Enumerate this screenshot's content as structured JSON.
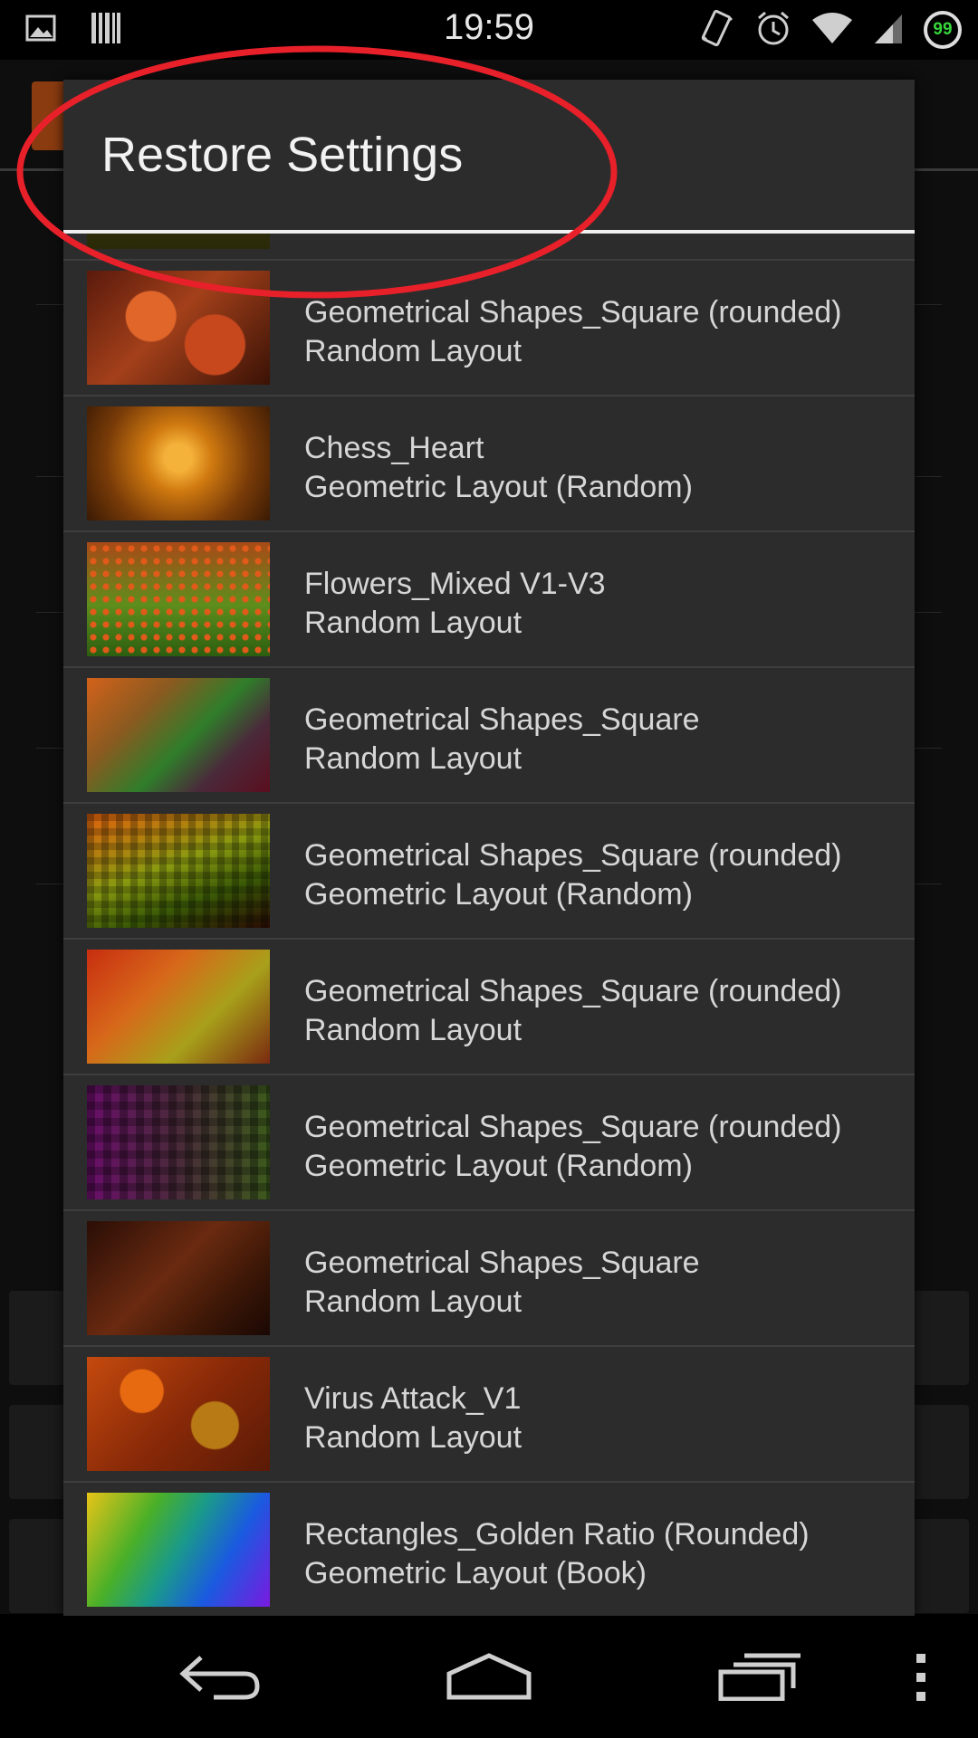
{
  "status_bar": {
    "time": "19:59",
    "battery_level": "99",
    "left_icons": [
      "image-icon",
      "barcode-icon"
    ],
    "right_icons": [
      "vibrate-icon",
      "alarm-icon",
      "wifi-icon",
      "signal-icon",
      "battery-icon"
    ]
  },
  "dialog": {
    "title": "Restore Settings",
    "items": [
      {
        "name": "",
        "layout": ""
      },
      {
        "name": "Geometrical Shapes_Square (rounded)",
        "layout": "Random Layout"
      },
      {
        "name": "Chess_Heart",
        "layout": "Geometric Layout (Random)"
      },
      {
        "name": "Flowers_Mixed V1-V3",
        "layout": "Random Layout"
      },
      {
        "name": "Geometrical Shapes_Square",
        "layout": "Random Layout"
      },
      {
        "name": "Geometrical Shapes_Square (rounded)",
        "layout": "Geometric Layout (Random)"
      },
      {
        "name": "Geometrical Shapes_Square (rounded)",
        "layout": "Random Layout"
      },
      {
        "name": "Geometrical Shapes_Square (rounded)",
        "layout": "Geometric Layout (Random)"
      },
      {
        "name": "Geometrical Shapes_Square",
        "layout": "Random Layout"
      },
      {
        "name": "Virus Attack_V1",
        "layout": "Random Layout"
      },
      {
        "name": "Rectangles_Golden Ratio (Rounded)",
        "layout": "Geometric Layout (Book)"
      }
    ]
  },
  "annotation": {
    "color": "#e8202a",
    "target": "dialog-title"
  },
  "nav_bar": {
    "icons": [
      "back-icon",
      "home-icon",
      "recent-apps-icon",
      "overflow-menu-icon"
    ]
  }
}
